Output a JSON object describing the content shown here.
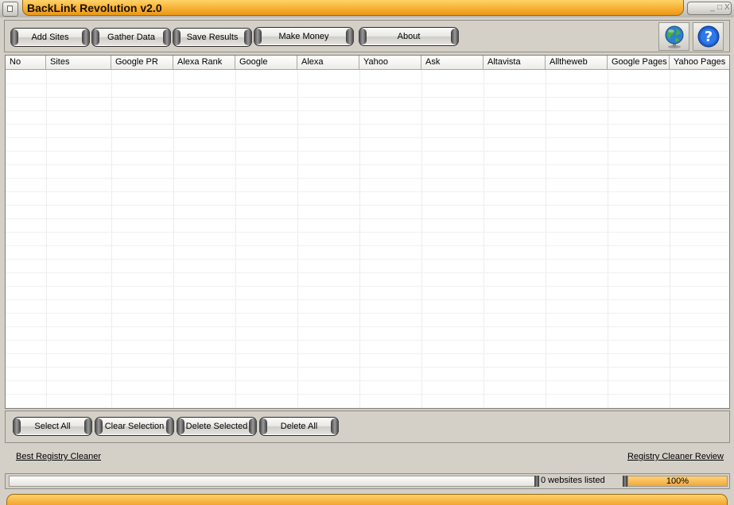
{
  "window": {
    "title": "BackLink Revolution v2.0",
    "controls": {
      "minimize": "_",
      "maximize": "□",
      "close": "X"
    }
  },
  "toolbar": {
    "buttons": [
      {
        "label": "Add Sites"
      },
      {
        "label": "Gather Data"
      },
      {
        "label": "Save Results"
      },
      {
        "label": "Make Money"
      },
      {
        "label": "About"
      }
    ],
    "icons": [
      {
        "name": "globe-icon"
      },
      {
        "name": "help-icon",
        "glyph": "?"
      }
    ]
  },
  "grid": {
    "columns": [
      "No",
      "Sites",
      "Google PR",
      "Alexa Rank",
      "Google",
      "Alexa",
      "Yahoo",
      "Ask",
      "Altavista",
      "Alltheweb",
      "Google Pages",
      "Yahoo Pages"
    ],
    "rows": []
  },
  "actions": {
    "buttons": [
      {
        "label": "Select All"
      },
      {
        "label": "Clear Selection"
      },
      {
        "label": "Delete Selected"
      },
      {
        "label": "Delete All"
      }
    ]
  },
  "links": {
    "left": "Best Registry Cleaner",
    "right": "Registry Cleaner Review"
  },
  "status": {
    "count_text": "0 websites listed",
    "progress_text": "100%",
    "progress_fraction": 1.0
  },
  "colors": {
    "accent_orange": "#f7ad2e",
    "window_bg": "#d4d0c8"
  }
}
